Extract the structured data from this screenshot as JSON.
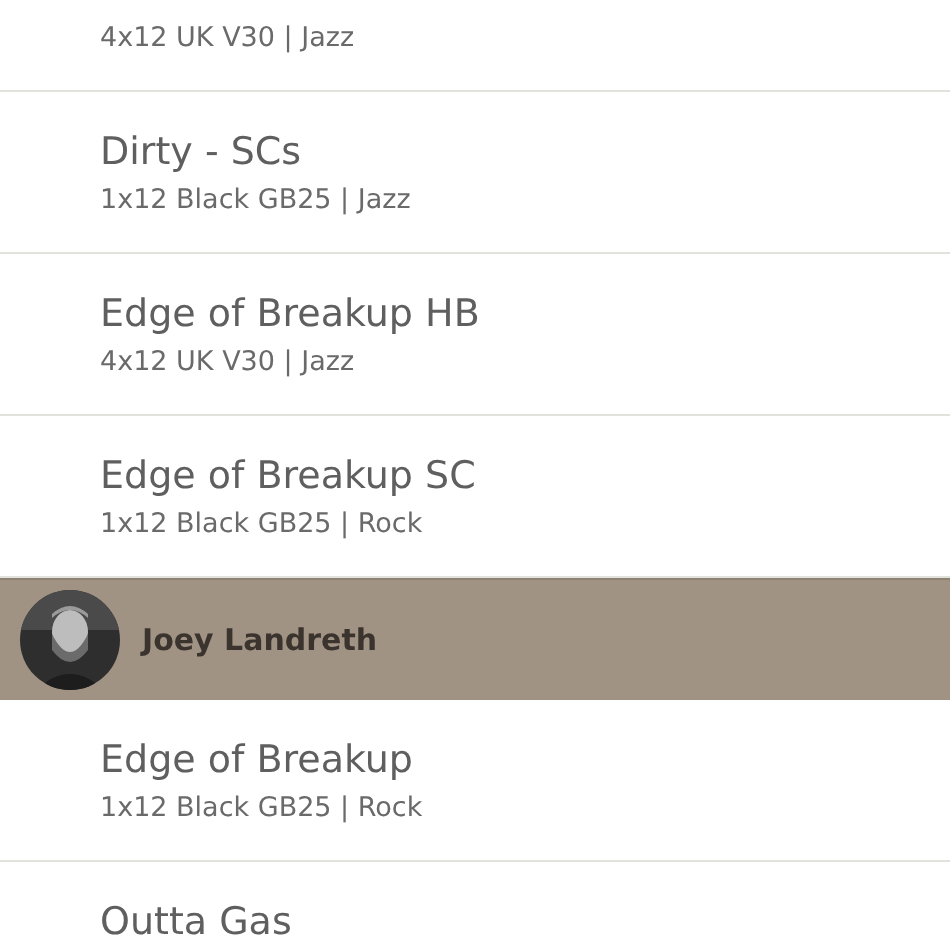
{
  "list": [
    {
      "kind": "item",
      "subtitle": "4x12 UK V30 | Jazz"
    },
    {
      "kind": "item",
      "title": "Dirty - SCs",
      "subtitle": "1x12 Black GB25 | Jazz"
    },
    {
      "kind": "item",
      "title": "Edge of Breakup HB",
      "subtitle": "4x12 UK V30 | Jazz"
    },
    {
      "kind": "item",
      "title": "Edge of Breakup SC",
      "subtitle": "1x12 Black GB25 | Rock"
    },
    {
      "kind": "header",
      "name": "Joey Landreth"
    },
    {
      "kind": "item",
      "title": "Edge of Breakup",
      "subtitle": "1x12 Black GB25 | Rock"
    },
    {
      "kind": "item",
      "title": "Outta Gas"
    }
  ]
}
